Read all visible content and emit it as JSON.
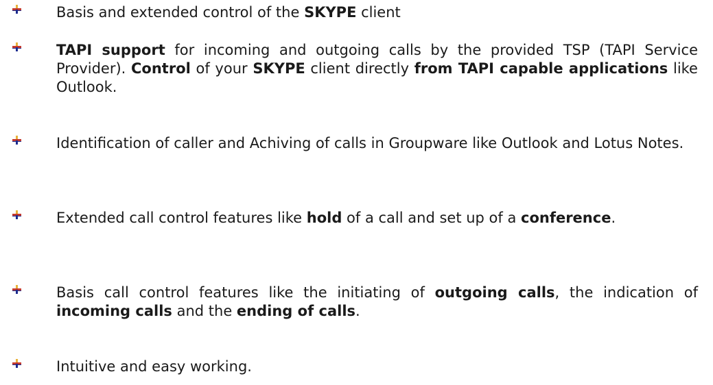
{
  "bullet_icon": "cross-bullet-icon",
  "bullet_colors": {
    "vertical_top": "#e8b23a",
    "vertical_bottom": "#1c2c8f",
    "horizontal": "#c43a2f"
  },
  "features": [
    {
      "segments": [
        {
          "text": "Basis and extended control of the ",
          "bold": false
        },
        {
          "text": "SKYPE",
          "bold": true
        },
        {
          "text": " client",
          "bold": false
        }
      ]
    },
    {
      "segments": [
        {
          "text": "TAPI support",
          "bold": true
        },
        {
          "text": " for incoming and outgoing calls by the provided TSP (TAPI Service Provider). ",
          "bold": false
        },
        {
          "text": "Control",
          "bold": true
        },
        {
          "text": " of your ",
          "bold": false
        },
        {
          "text": "SKYPE",
          "bold": true
        },
        {
          "text": " client directly ",
          "bold": false
        },
        {
          "text": "from TAPI capable applications",
          "bold": true
        },
        {
          "text": " like Outlook.",
          "bold": false
        }
      ]
    },
    {
      "segments": [
        {
          "text": "Identification of caller and Achiving of calls in Groupware like Outlook and Lotus Notes.",
          "bold": false
        }
      ]
    },
    {
      "segments": [
        {
          "text": "Extended call control features like ",
          "bold": false
        },
        {
          "text": "hold",
          "bold": true
        },
        {
          "text": " of a call and set up of a ",
          "bold": false
        },
        {
          "text": "conference",
          "bold": true
        },
        {
          "text": ".",
          "bold": false
        }
      ]
    },
    {
      "segments": [
        {
          "text": "Basis call control features like the initiating of ",
          "bold": false
        },
        {
          "text": "outgoing calls",
          "bold": true
        },
        {
          "text": ", the indication of ",
          "bold": false
        },
        {
          "text": "incoming calls",
          "bold": true
        },
        {
          "text": " and the ",
          "bold": false
        },
        {
          "text": "ending of calls",
          "bold": true
        },
        {
          "text": ".",
          "bold": false
        }
      ]
    },
    {
      "segments": [
        {
          "text": "Intuitive and easy working.",
          "bold": false
        }
      ]
    }
  ]
}
